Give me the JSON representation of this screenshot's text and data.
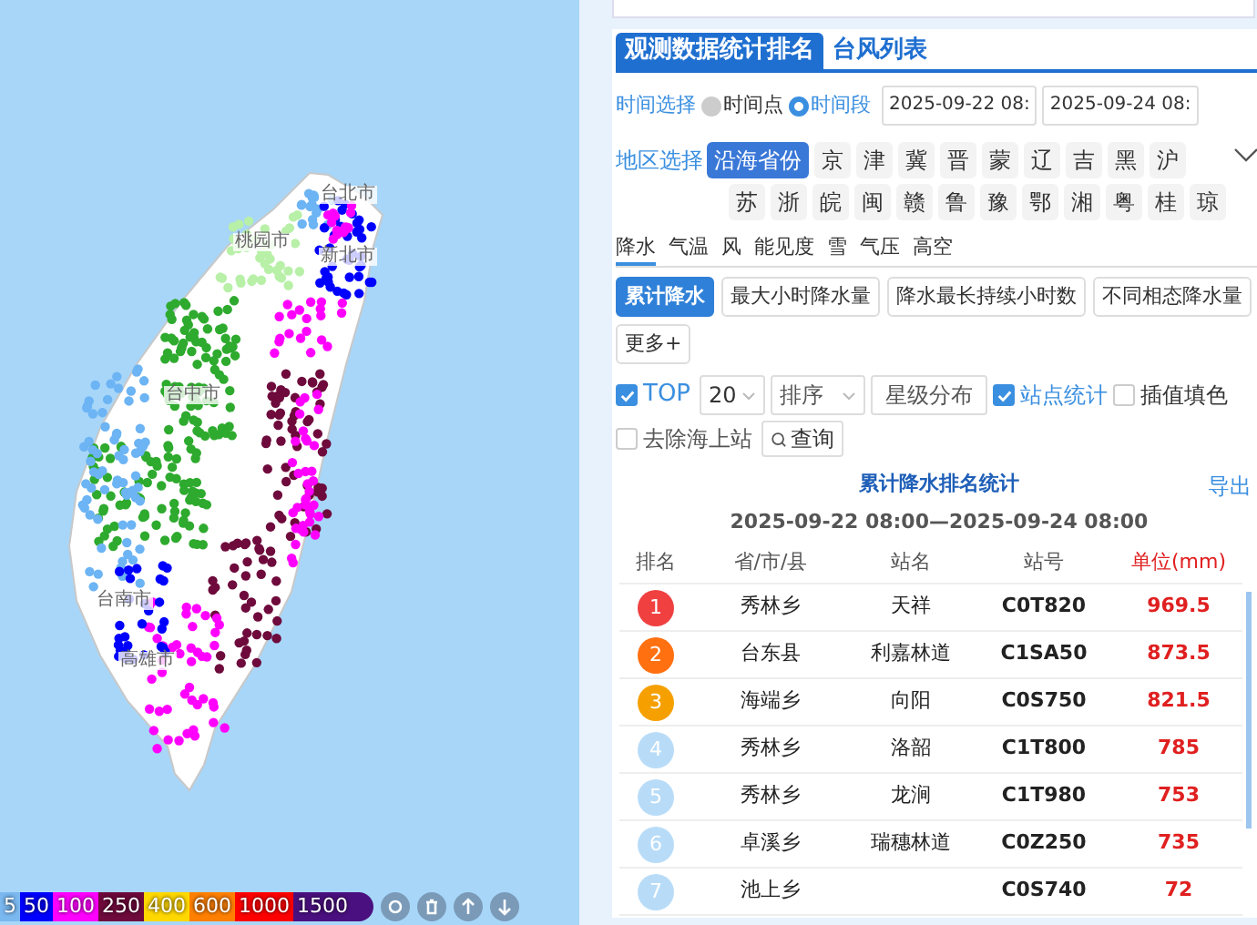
{
  "map": {
    "cities": [
      {
        "name": "台北市"
      },
      {
        "name": "桃园市"
      },
      {
        "name": "新北市"
      },
      {
        "name": "台中市"
      },
      {
        "name": "台南市"
      },
      {
        "name": "高雄市"
      }
    ],
    "legend": [
      {
        "label": "5",
        "color": "#7ab8f0"
      },
      {
        "label": "50",
        "color": "#0000ff"
      },
      {
        "label": "100",
        "color": "#ff00ff"
      },
      {
        "label": "250",
        "color": "#6e0a3c"
      },
      {
        "label": "400",
        "color": "#ffd800"
      },
      {
        "label": "600",
        "color": "#ff8000"
      },
      {
        "label": "1000",
        "color": "#ff0000"
      },
      {
        "label": "1500",
        "color": "#4b1080"
      }
    ]
  },
  "tabs": [
    {
      "label": "观测数据统计排名",
      "selected": true
    },
    {
      "label": "台风列表",
      "selected": false
    }
  ],
  "time": {
    "label": "时间选择",
    "options": [
      {
        "label": "时间点",
        "selected": false
      },
      {
        "label": "时间段",
        "selected": true
      }
    ],
    "start": "2025-09-22 08:",
    "end": "2025-09-24 08:"
  },
  "region": {
    "label": "地区选择",
    "items": [
      {
        "label": "沿海省份",
        "selected": true
      },
      {
        "label": "京",
        "selected": false
      },
      {
        "label": "津",
        "selected": false
      },
      {
        "label": "冀",
        "selected": false
      },
      {
        "label": "晋",
        "selected": false
      },
      {
        "label": "蒙",
        "selected": false
      },
      {
        "label": "辽",
        "selected": false
      },
      {
        "label": "吉",
        "selected": false
      },
      {
        "label": "黑",
        "selected": false
      },
      {
        "label": "沪",
        "selected": false
      },
      {
        "label": "苏",
        "selected": false
      },
      {
        "label": "浙",
        "selected": false
      },
      {
        "label": "皖",
        "selected": false
      },
      {
        "label": "闽",
        "selected": false
      },
      {
        "label": "赣",
        "selected": false
      },
      {
        "label": "鲁",
        "selected": false
      },
      {
        "label": "豫",
        "selected": false
      },
      {
        "label": "鄂",
        "selected": false
      },
      {
        "label": "湘",
        "selected": false
      },
      {
        "label": "粤",
        "selected": false
      },
      {
        "label": "桂",
        "selected": false
      },
      {
        "label": "琼",
        "selected": false
      }
    ]
  },
  "elements": [
    {
      "label": "降水",
      "selected": true
    },
    {
      "label": "气温",
      "selected": false
    },
    {
      "label": "风",
      "selected": false
    },
    {
      "label": "能见度",
      "selected": false
    },
    {
      "label": "雪",
      "selected": false
    },
    {
      "label": "气压",
      "selected": false
    },
    {
      "label": "高空",
      "selected": false
    }
  ],
  "stat_types": [
    {
      "label": "累计降水",
      "selected": true
    },
    {
      "label": "最大小时降水量",
      "selected": false
    },
    {
      "label": "降水最长持续小时数",
      "selected": false
    },
    {
      "label": "不同相态降水量",
      "selected": false
    },
    {
      "label": "更多+",
      "selected": false
    }
  ],
  "options": {
    "top": {
      "label": "TOP",
      "checked": true
    },
    "count": "20",
    "sort": "排序",
    "star_button": "星级分布",
    "station_stats": {
      "label": "站点统计",
      "checked": true
    },
    "fill": {
      "label": "插值填色",
      "checked": false
    },
    "remove_sea": {
      "label": "去除海上站",
      "checked": false
    },
    "query": "查询"
  },
  "table": {
    "title": "累计降水排名统计",
    "export": "导出",
    "range": "2025-09-22 08:00—2025-09-24 08:00",
    "columns": [
      "排名",
      "省/市/县",
      "站名",
      "站号",
      "单位(mm)"
    ],
    "rows": [
      {
        "rank": "1",
        "color": "#f04040",
        "county": "秀林乡",
        "station": "天祥",
        "code": "C0T820",
        "value": "969.5"
      },
      {
        "rank": "2",
        "color": "#ff7010",
        "county": "台东县",
        "station": "利嘉林道",
        "code": "C1SA50",
        "value": "873.5"
      },
      {
        "rank": "3",
        "color": "#f5a000",
        "county": "海端乡",
        "station": "向阳",
        "code": "C0S750",
        "value": "821.5"
      },
      {
        "rank": "4",
        "color": "#b8dcf8",
        "county": "秀林乡",
        "station": "洛韶",
        "code": "C1T800",
        "value": "785"
      },
      {
        "rank": "5",
        "color": "#b8dcf8",
        "county": "秀林乡",
        "station": "龙涧",
        "code": "C1T980",
        "value": "753"
      },
      {
        "rank": "6",
        "color": "#b8dcf8",
        "county": "卓溪乡",
        "station": "瑞穗林道",
        "code": "C0Z250",
        "value": "735"
      },
      {
        "rank": "7",
        "color": "#b8dcf8",
        "county": "池上乡",
        "code": "C0S740",
        "value": "72"
      }
    ]
  }
}
